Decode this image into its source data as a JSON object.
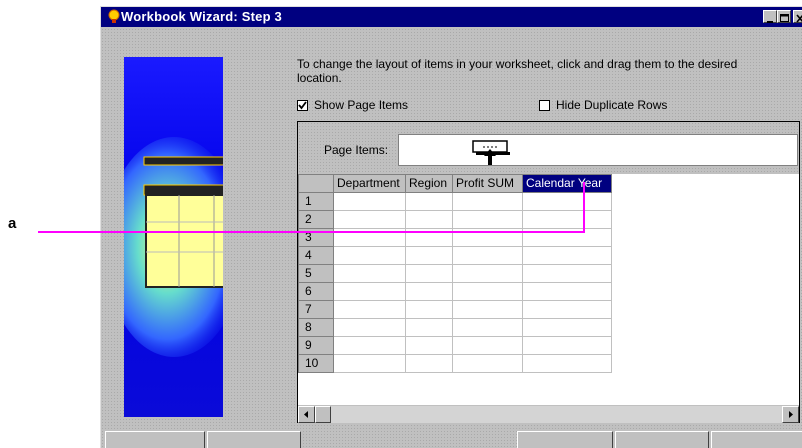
{
  "window": {
    "title": "Workbook Wizard: Step 3",
    "controls": [
      "minimize-icon",
      "maximize-icon",
      "close-icon"
    ]
  },
  "instructions": "To change the layout of items in your worksheet, click and drag them to the desired location.",
  "options": {
    "show_page_items": {
      "label": "Show Page Items",
      "checked": true
    },
    "hide_duplicate_rows": {
      "label": "Hide Duplicate Rows",
      "checked": false
    }
  },
  "page_items": {
    "label": "Page Items:"
  },
  "grid": {
    "columns": [
      "Department",
      "Region",
      "Profit SUM",
      "Calendar Year"
    ],
    "selected_column": "Calendar Year",
    "rows": [
      "1",
      "2",
      "3",
      "4",
      "5",
      "6",
      "7",
      "8",
      "9",
      "10"
    ]
  },
  "callout": {
    "label": "a"
  },
  "colors": {
    "title_bar": "#000080",
    "selection": "#000080",
    "callout_line": "#ff00ff",
    "dialog_bg": "#c0c0c0"
  },
  "icons": [
    "wizard-bulb-icon",
    "clapperboard-illustration",
    "drag-cursor-icon",
    "scroll-left-icon",
    "scroll-right-icon"
  ]
}
